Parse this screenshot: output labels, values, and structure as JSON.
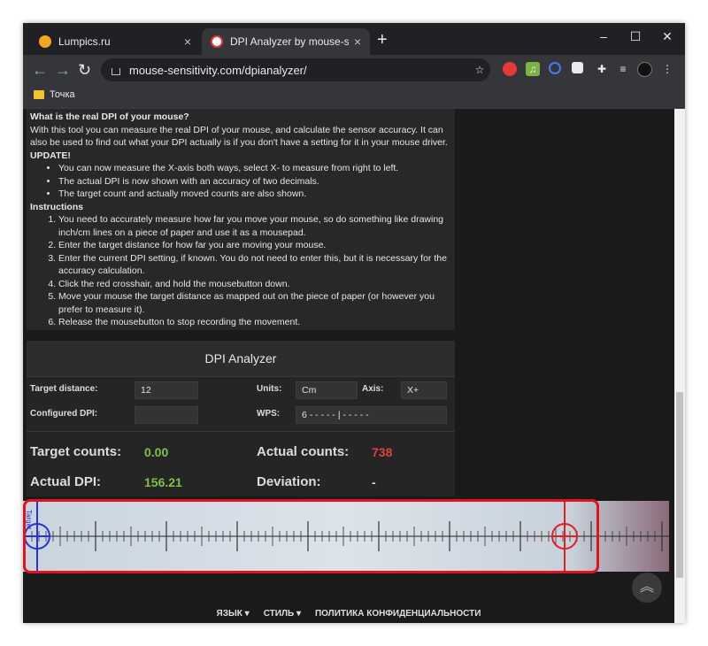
{
  "browser": {
    "tabs": [
      {
        "title": "Lumpics.ru",
        "close": "×"
      },
      {
        "title": "DPI Analyzer by mouse-sensitivit",
        "close": "×"
      }
    ],
    "new_tab": "+",
    "window_controls": [
      "–",
      "☐",
      "✕"
    ],
    "url": "mouse-sensitivity.com/dpianalyzer/",
    "bookmark": "Точка"
  },
  "info": {
    "heading": "What is the real DPI of your mouse?",
    "intro": "With this tool you can measure the real DPI of your mouse, and calculate the sensor accuracy. It can also be used to find out what your DPI actually is if you don't have a setting for it in your mouse driver.",
    "update_heading": "UPDATE!",
    "updates": [
      "You can now measure the X-axis both ways, select X- to measure from right to left.",
      "The actual DPI is now shown with an accuracy of two decimals.",
      "The target count and actually moved counts are also shown."
    ],
    "instructions_heading": "Instructions",
    "instructions": [
      "You need to accurately measure how far you move your mouse, so do something like drawing inch/cm lines on a piece of paper and use it as a mousepad.",
      "Enter the target distance for how far you are moving your mouse.",
      "Enter the current DPI setting, if known. You do not need to enter this, but it is necessary for the accuracy calculation.",
      "Click the red crosshair, and hold the mousebutton down.",
      "Move your mouse the target distance as mapped out on the piece of paper (or however you prefer to measure it).",
      "Release the mousebutton to stop recording the movement."
    ]
  },
  "analyzer": {
    "title": "DPI Analyzer",
    "target_distance_label": "Target distance:",
    "target_distance_value": "12",
    "configured_dpi_label": "Configured DPI:",
    "configured_dpi_value": "",
    "units_label": "Units:",
    "units_value": "Cm",
    "axis_label": "Axis:",
    "axis_value": "X+",
    "wps_label": "WPS:",
    "wps_value": "6  - - - - - | - - - - -",
    "target_counts_label": "Target counts:",
    "target_counts_value": "0.00",
    "actual_counts_label": "Actual counts:",
    "actual_counts_value": "738",
    "actual_dpi_label": "Actual DPI:",
    "actual_dpi_value": "156.21",
    "deviation_label": "Deviation:",
    "deviation_value": "-",
    "ruler_target_label": "Target"
  },
  "footer": {
    "language": "ЯЗЫК ▾",
    "style": "СТИЛЬ ▾",
    "privacy": "ПОЛИТИКА КОНФИДЕНЦИАЛЬНОСТИ"
  },
  "colors": {
    "highlight": "#e0141e",
    "green_value": "#7ec242",
    "red_value": "#e0433c",
    "blue_crosshair": "#2233dd",
    "red_crosshair": "#e02020"
  }
}
